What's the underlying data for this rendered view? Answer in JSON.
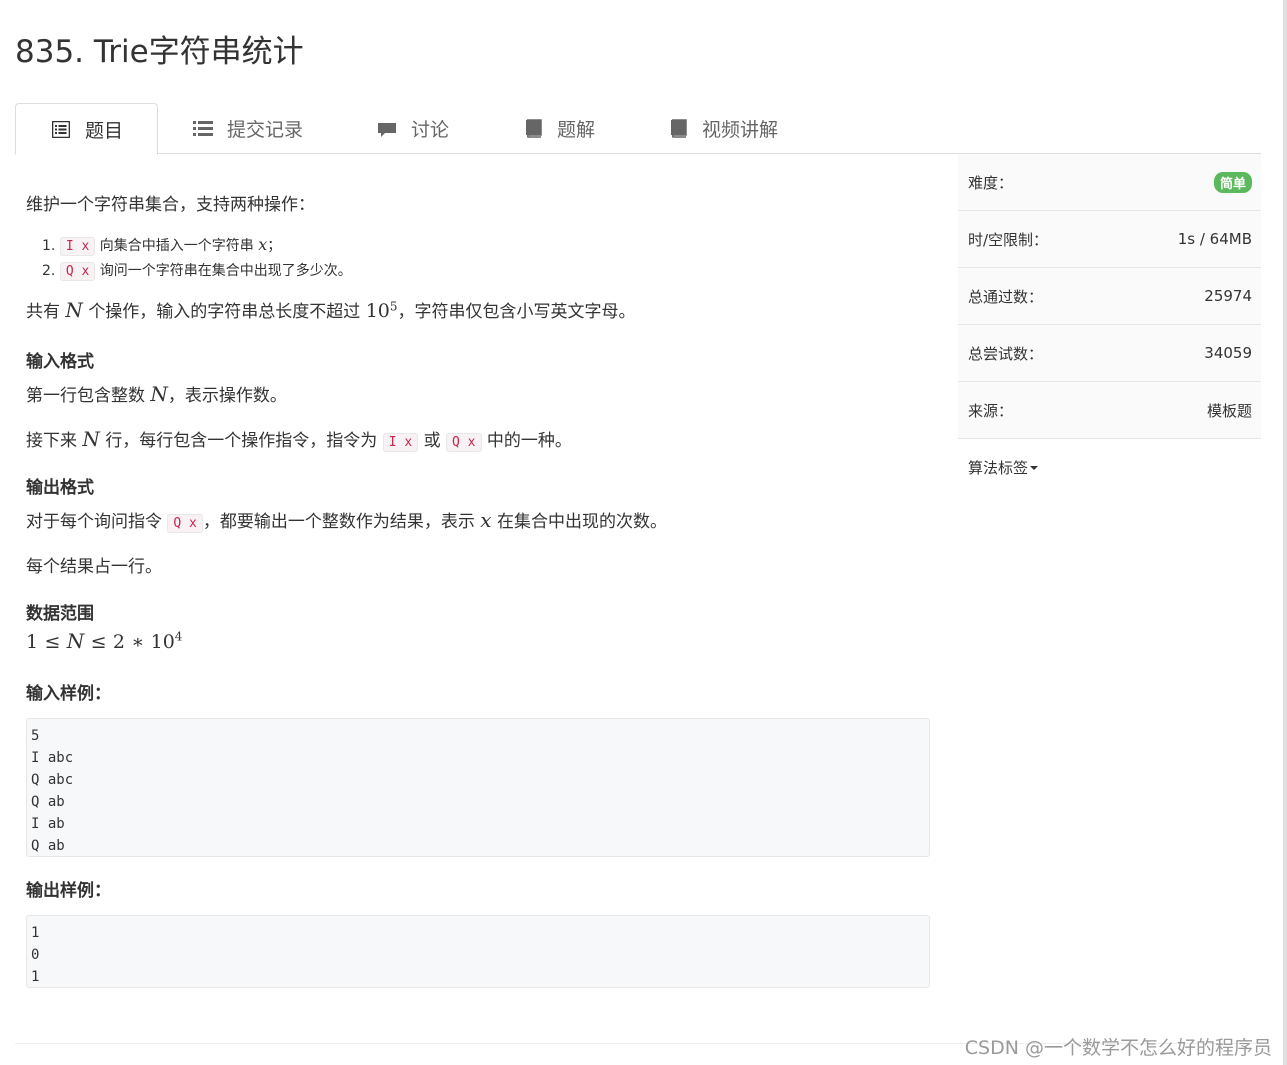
{
  "title": "835. Trie字符串统计",
  "tabs": [
    {
      "label": "题目",
      "icon": "list-alt-icon"
    },
    {
      "label": "提交记录",
      "icon": "list-icon"
    },
    {
      "label": "讨论",
      "icon": "comment-icon"
    },
    {
      "label": "题解",
      "icon": "book-icon"
    },
    {
      "label": "视频讲解",
      "icon": "book-icon"
    }
  ],
  "problem": {
    "intro": "维护一个字符串集合，支持两种操作：",
    "ops": [
      {
        "num": "1.",
        "code": "I x",
        "text1": "向集合中插入一个字符串",
        "var": "x",
        "text2": "；"
      },
      {
        "num": "2.",
        "code": "Q x",
        "text1": "询问一个字符串在集合中出现了多少次。",
        "var": "",
        "text2": ""
      }
    ],
    "constraint": {
      "pre": "共有",
      "N": "N",
      "mid": "个操作，输入的字符串总长度不超过",
      "base": "10",
      "exp": "5",
      "post": "，字符串仅包含小写英文字母。"
    },
    "input_title": "输入格式",
    "input_line1": {
      "pre": "第一行包含整数",
      "N": "N",
      "post": "，表示操作数。"
    },
    "input_line2": {
      "pre": "接下来",
      "N": "N",
      "mid": "行，每行包含一个操作指令，指令为",
      "code1": "I x",
      "or": "或",
      "code2": "Q x",
      "post": "中的一种。"
    },
    "output_title": "输出格式",
    "output_line1": {
      "pre": "对于每个询问指令",
      "code": "Q x",
      "mid": "，都要输出一个整数作为结果，表示",
      "var": "x",
      "post": "在集合中出现的次数。"
    },
    "output_line2": "每个结果占一行。",
    "range_title": "数据范围",
    "range": {
      "a": "1",
      "le1": "≤",
      "N": "N",
      "le2": "≤",
      "b": "2",
      "star": "∗",
      "base": "10",
      "exp": "4"
    },
    "sample_in_title": "输入样例：",
    "sample_in": [
      "5",
      "I abc",
      "Q abc",
      "Q ab",
      "I ab",
      "Q ab"
    ],
    "sample_out_title": "输出样例：",
    "sample_out": [
      "1",
      "0",
      "1"
    ]
  },
  "sidebar": {
    "difficulty_label": "难度：",
    "difficulty_value": "简单",
    "difficulty_color": "#5cb85c",
    "limit_label": "时/空限制：",
    "limit_value": "1s / 64MB",
    "passed_label": "总通过数：",
    "passed_value": "25974",
    "tried_label": "总尝试数：",
    "tried_value": "34059",
    "source_label": "来源：",
    "source_value": "模板题",
    "tags_label": "算法标签"
  },
  "watermark": "CSDN @一个数学不怎么好的程序员"
}
